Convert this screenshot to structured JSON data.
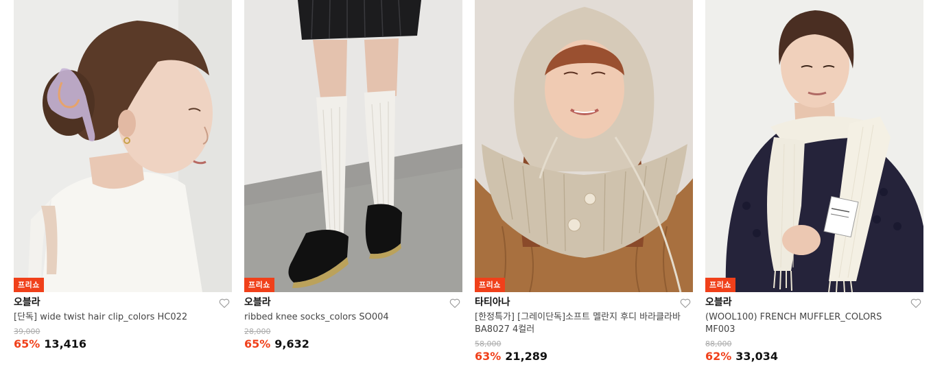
{
  "colors": {
    "accent": "#f0401a",
    "badge_bg": "#f0401a",
    "price": "#111111",
    "muted": "#aaaaaa"
  },
  "products": [
    {
      "badge": "프리쇼",
      "brand": "오블라",
      "title": "[단독] wide twist hair clip_colors HC022",
      "original_price": "39,000",
      "discount": "65%",
      "price": "13,416",
      "image": "woman-hair-clip-photo",
      "wishlist_icon": "heart-outline-icon"
    },
    {
      "badge": "프리쇼",
      "brand": "오블라",
      "title": "ribbed knee socks_colors SO004",
      "original_price": "28,000",
      "discount": "65%",
      "price": "9,632",
      "image": "knee-socks-loafers-photo",
      "wishlist_icon": "heart-outline-icon"
    },
    {
      "badge": "프리쇼",
      "brand": "타티아나",
      "title": "[한정특가] [그레이단독]소프트 멜란지 후디 바라클라바 BA8027 4컬러",
      "original_price": "58,000",
      "discount": "63%",
      "price": "21,289",
      "image": "knit-hood-balaclava-photo",
      "wishlist_icon": "heart-outline-icon"
    },
    {
      "badge": "프리쇼",
      "brand": "오블라",
      "title": "(WOOL100) FRENCH MUFFLER_COLORS MF003",
      "original_price": "88,000",
      "discount": "62%",
      "price": "33,034",
      "image": "wool-muffler-photo",
      "wishlist_icon": "heart-outline-icon"
    }
  ]
}
